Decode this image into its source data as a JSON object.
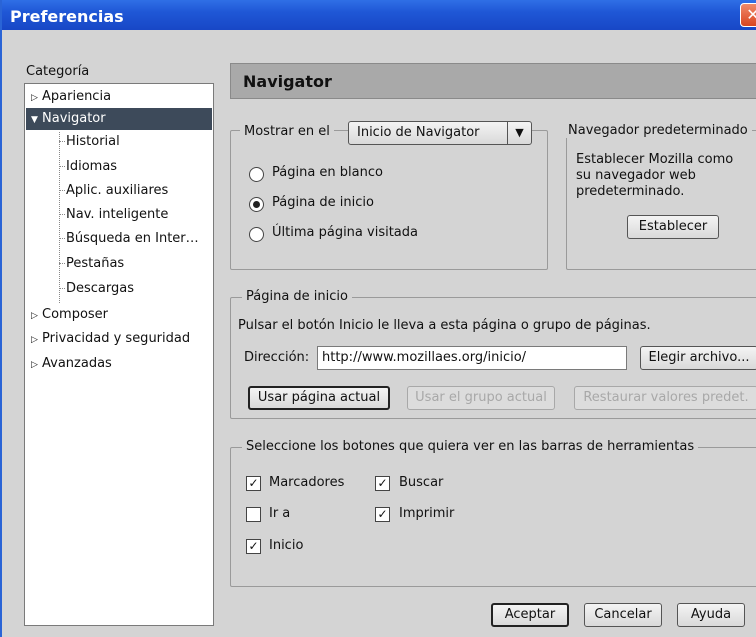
{
  "window": {
    "title": "Preferencias",
    "close_glyph": "✕"
  },
  "category": {
    "label": "Categoría",
    "items": [
      "Apariencia",
      "Navigator",
      "Composer",
      "Privacidad y seguridad",
      "Avanzadas"
    ],
    "navigator_children": [
      "Historial",
      "Idiomas",
      "Aplic. auxiliares",
      "Nav. inteligente",
      "Búsqueda en Inter…",
      "Pestañas",
      "Descargas"
    ]
  },
  "panel": {
    "title": "Navigator"
  },
  "startup": {
    "legend": "Mostrar en el",
    "select_value": "Inicio de Navigator",
    "options": [
      "Página en blanco",
      "Página de inicio",
      "Última página visitada"
    ],
    "selected_index": 1
  },
  "default_browser": {
    "legend": "Navegador predeterminado",
    "text": "Establecer Mozilla como su navegador web predeterminado.",
    "button": "Establecer"
  },
  "homepage": {
    "legend": "Página de inicio",
    "description": "Pulsar el botón Inicio le lleva a esta página o grupo de páginas.",
    "address_label": "Dirección:",
    "address_value": "http://www.mozillaes.org/inicio/",
    "choose_file": "Elegir archivo...",
    "use_current_page": "Usar página actual",
    "use_current_group": "Usar el grupo actual",
    "restore_defaults": "Restaurar valores predet."
  },
  "toolbars": {
    "legend": "Seleccione los botones que quiera ver en las barras de herramientas",
    "checks": {
      "bookmarks": {
        "label": "Marcadores",
        "checked": true
      },
      "search": {
        "label": "Buscar",
        "checked": true
      },
      "goto": {
        "label": "Ir a",
        "checked": false
      },
      "print": {
        "label": "Imprimir",
        "checked": true
      },
      "home": {
        "label": "Inicio",
        "checked": true
      }
    }
  },
  "footer": {
    "ok": "Aceptar",
    "cancel": "Cancelar",
    "help": "Ayuda"
  }
}
